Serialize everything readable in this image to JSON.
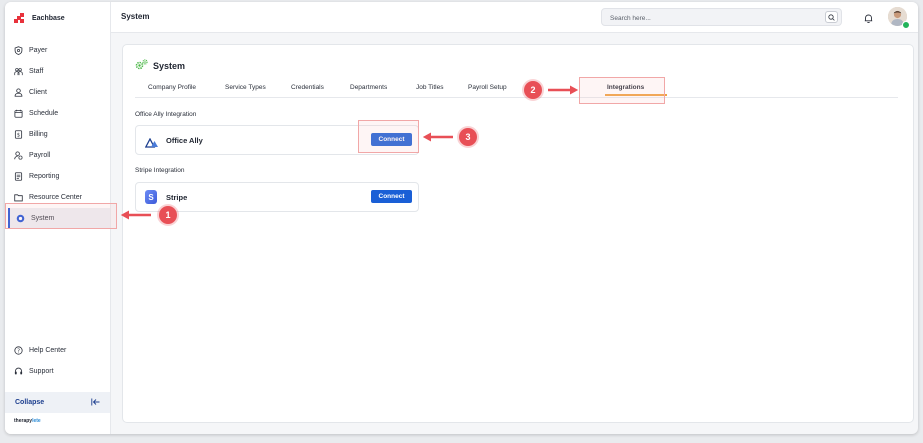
{
  "app": {
    "brand": "Eachbase",
    "footer_brand_a": "therapy",
    "footer_brand_b": "lete"
  },
  "sidebar": {
    "items": [
      {
        "label": "Payer",
        "icon": "shield-icon"
      },
      {
        "label": "Staff",
        "icon": "staff-icon"
      },
      {
        "label": "Client",
        "icon": "user-icon"
      },
      {
        "label": "Schedule",
        "icon": "calendar-icon"
      },
      {
        "label": "Billing",
        "icon": "billing-icon"
      },
      {
        "label": "Payroll",
        "icon": "payroll-icon"
      },
      {
        "label": "Reporting",
        "icon": "report-icon"
      },
      {
        "label": "Resource Center",
        "icon": "folder-icon"
      },
      {
        "label": "System",
        "icon": "system-icon"
      }
    ],
    "bottom": [
      {
        "label": "Help Center",
        "icon": "help-icon"
      },
      {
        "label": "Support",
        "icon": "headset-icon"
      }
    ],
    "collapse_label": "Collapse"
  },
  "topbar": {
    "title": "System",
    "search_placeholder": "Search here..."
  },
  "page": {
    "title": "System",
    "tabs": [
      "Company Profile",
      "Service Types",
      "Credentials",
      "Departments",
      "Job Titles",
      "Payroll Setup",
      "Integrations"
    ],
    "active_tab": "Integrations",
    "sections": [
      {
        "label": "Office Ally Integration",
        "name": "Office Ally",
        "button": "Connect"
      },
      {
        "label": "Stripe Integration",
        "name": "Stripe",
        "button": "Connect"
      }
    ]
  },
  "annotations": {
    "badge1": "1",
    "badge2": "2",
    "badge3": "3"
  },
  "colors": {
    "accent": "#1a5fd6",
    "annotation": "#e84f56",
    "tab_underline": "#f0a040",
    "gear": "#4cb848"
  }
}
